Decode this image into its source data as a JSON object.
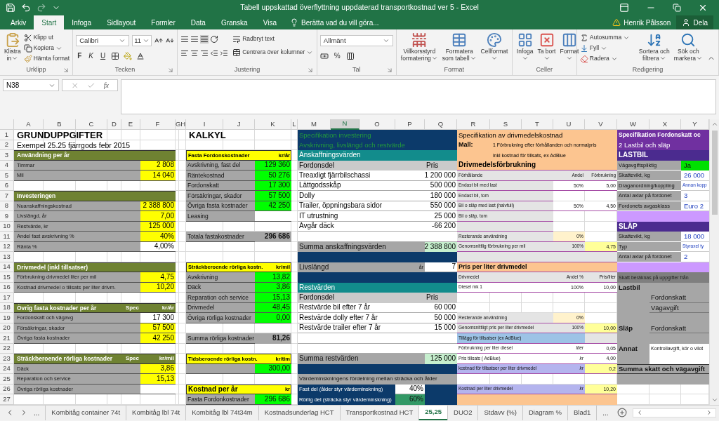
{
  "window": {
    "title": "Tabell uppskattad överflyttning uppdaterad transportkostnad ver 5 - Excel"
  },
  "tabs": [
    {
      "label": "Arkiv",
      "selected": false
    },
    {
      "label": "Start",
      "selected": true
    },
    {
      "label": "Infoga",
      "selected": false
    },
    {
      "label": "Sidlayout",
      "selected": false
    },
    {
      "label": "Formler",
      "selected": false
    },
    {
      "label": "Data",
      "selected": false
    },
    {
      "label": "Granska",
      "selected": false
    },
    {
      "label": "Visa",
      "selected": false
    }
  ],
  "tell_me": "Berätta vad du vill göra...",
  "user": "Henrik Pålsson",
  "share": "Dela",
  "ribbon": {
    "clipboard": {
      "paste": [
        "Klistra",
        "in"
      ],
      "cut": "Klipp ut",
      "copy": "Kopiera",
      "painter": "Hämta format",
      "label": "Urklipp"
    },
    "font": {
      "name": "Calibri",
      "size": "11",
      "bold": "F",
      "italic": "K",
      "underline": "U",
      "label": "Tecken"
    },
    "alignment": {
      "wrap": "Radbryt text",
      "merge": "Centrera över kolumner",
      "label": "Justering"
    },
    "number": {
      "format": "Allmänt",
      "percent": "%",
      "label": "Tal"
    },
    "styles": {
      "conditional": [
        "Villkorsstyrd",
        "formatering"
      ],
      "table": [
        "Formatera",
        "som tabell"
      ],
      "cell": [
        "Cellformat"
      ],
      "label": "Format"
    },
    "cells": {
      "insert": "Infoga",
      "delete": "Ta bort",
      "format": "Format",
      "label": "Celler"
    },
    "editing": {
      "autosum": "Autosumma",
      "fill": "Fyll",
      "clear": "Radera",
      "sort": [
        "Sortera och",
        "filtrera"
      ],
      "find": [
        "Sök och",
        "markera"
      ],
      "label": "Redigering"
    }
  },
  "formula_bar": {
    "name_box": "N38",
    "fx": "fx"
  },
  "sheet": {
    "columns": [
      {
        "label": "A",
        "selected": false
      },
      {
        "label": "B",
        "selected": false
      },
      {
        "label": "C",
        "selected": false
      },
      {
        "label": "D",
        "selected": false
      },
      {
        "label": "E",
        "selected": false
      },
      {
        "label": "F",
        "selected": false
      },
      {
        "label": "GH",
        "selected": false
      },
      {
        "label": "I",
        "selected": false
      },
      {
        "label": "J",
        "selected": false
      },
      {
        "label": "K",
        "selected": false
      },
      {
        "label": "L",
        "selected": false
      },
      {
        "label": "M",
        "selected": false
      },
      {
        "label": "N",
        "selected": true
      },
      {
        "label": "O",
        "selected": false
      },
      {
        "label": "P",
        "selected": false
      },
      {
        "label": "Q",
        "selected": false
      },
      {
        "label": "R",
        "selected": false
      },
      {
        "label": "S",
        "selected": false
      },
      {
        "label": "T",
        "selected": false
      },
      {
        "label": "U",
        "selected": false
      },
      {
        "label": "V",
        "selected": false
      },
      {
        "label": "W",
        "selected": false
      },
      {
        "label": "X",
        "selected": false
      },
      {
        "label": "Y",
        "selected": false
      }
    ],
    "rows": [
      "1",
      "2",
      "3",
      "4",
      "5",
      "6",
      "7",
      "8",
      "9",
      "10",
      "11",
      "12",
      "13",
      "14",
      "15",
      "16",
      "17",
      "18",
      "19",
      "20",
      "21",
      "22",
      "23",
      "24",
      "25",
      "26",
      "27"
    ],
    "cells": [
      {
        "text": "GRUNDUPPGIFTER",
        "kind": "title"
      },
      {
        "text": "Exempel 25.25 fjärrgods febr 2015",
        "kind": "note"
      },
      {
        "text": "Användning per år",
        "kind": "olive"
      },
      {
        "text": "Timmar",
        "kind": "gray"
      },
      {
        "text": "2 808",
        "kind": "yellow"
      },
      {
        "text": "Mil",
        "kind": "gray"
      },
      {
        "text": "14 040",
        "kind": "yellow"
      },
      {
        "text": "Investeringen",
        "kind": "olive"
      },
      {
        "text": "Nuanskaffningskostnad",
        "kind": "gray"
      },
      {
        "text": "2 388 800",
        "kind": "yellow"
      },
      {
        "text": "Livslängd, år",
        "kind": "gray"
      },
      {
        "text": "7,00",
        "kind": "yellow"
      },
      {
        "text": "Restvärde, kr",
        "kind": "gray"
      },
      {
        "text": "125 000",
        "kind": "yellow"
      },
      {
        "text": "Andel fast avskrivning %",
        "kind": "gray"
      },
      {
        "text": "40%",
        "kind": "yellow"
      },
      {
        "text": "Ränta %",
        "kind": "gray"
      },
      {
        "text": "4,00%",
        "kind": "white"
      },
      {
        "text": "Drivmedel (inkl tillsatser)",
        "kind": "olive"
      },
      {
        "text": "Förbrukning drivmedel liter per mil",
        "kind": "gray"
      },
      {
        "text": "4,75",
        "kind": "yellow"
      },
      {
        "text": "Kostnad drivmedel o tillsats per liter drivm.",
        "kind": "gray"
      },
      {
        "text": "10,20",
        "kind": "yellow"
      },
      {
        "text": "Övrig fasta kostnader per år",
        "kind": "olive"
      },
      {
        "text": "Spec",
        "kind": "oliver"
      },
      {
        "text": "kr/år",
        "kind": "oliver"
      },
      {
        "text": "Fordonskatt och vägavg",
        "kind": "gray"
      },
      {
        "text": "17 300",
        "kind": "white"
      },
      {
        "text": "Försäkringar, skador",
        "kind": "gray"
      },
      {
        "text": "57 500",
        "kind": "yellow"
      },
      {
        "text": "Övriga fasta kostnader",
        "kind": "gray"
      },
      {
        "text": "42 250",
        "kind": "yellow"
      },
      {
        "text": "Sträckberoende rörliga kostnader",
        "kind": "olive"
      },
      {
        "text": "Spec",
        "kind": "oliver"
      },
      {
        "text": "kr/mil",
        "kind": "oliver"
      },
      {
        "text": "Däck",
        "kind": "gray"
      },
      {
        "text": "3,86",
        "kind": "yellow"
      },
      {
        "text": "Reparation och service",
        "kind": "gray"
      },
      {
        "text": "15,13",
        "kind": "yellow"
      },
      {
        "text": "Övriga rörliga kostnader",
        "kind": "gray"
      },
      {
        "kind": "white"
      },
      {
        "text": "KALKYL",
        "kind": "title"
      },
      {
        "text": "Fasta Fordonskostnader",
        "kind": "ybar"
      },
      {
        "text": "kr/år",
        "kind": "ybarr"
      },
      {
        "text": "Avskrivning, fast del",
        "kind": "grayl"
      },
      {
        "text": "129 360",
        "kind": "green"
      },
      {
        "text": "Räntekostnad",
        "kind": "grayl"
      },
      {
        "text": "50 276",
        "kind": "green"
      },
      {
        "text": "Fordonskatt",
        "kind": "grayl"
      },
      {
        "text": "17 300",
        "kind": "green"
      },
      {
        "text": "Försäkringar, skador",
        "kind": "grayl"
      },
      {
        "text": "57 500",
        "kind": "green"
      },
      {
        "text": "Övriga fasta kostnader",
        "kind": "grayl"
      },
      {
        "text": "42 250",
        "kind": "green"
      },
      {
        "text": "Leasing",
        "kind": "grayl"
      },
      {
        "kind": "white"
      },
      {
        "text": "Totala fastakostnader",
        "kind": "grayl"
      },
      {
        "text": "296 686",
        "kind": "graytot"
      },
      {
        "text": "Sträckberoende rörliga kostn.",
        "kind": "ybar"
      },
      {
        "text": "kr/mil",
        "kind": "ybarr"
      },
      {
        "text": "Avskrivning",
        "kind": "grayl"
      },
      {
        "text": "13,82",
        "kind": "green"
      },
      {
        "text": "Däck",
        "kind": "grayl"
      },
      {
        "text": "3,86",
        "kind": "green"
      },
      {
        "text": "Reparation och service",
        "kind": "grayl"
      },
      {
        "text": "15,13",
        "kind": "green"
      },
      {
        "text": "Drivmedel",
        "kind": "grayl"
      },
      {
        "text": "48,45",
        "kind": "green"
      },
      {
        "text": "Övriga rörliga kostnader",
        "kind": "grayl"
      },
      {
        "text": "0,00",
        "kind": "green"
      },
      {
        "text": "Summa rörliga kostnader",
        "kind": "grayl"
      },
      {
        "text": "81,26",
        "kind": "graytot"
      },
      {
        "text": "Tidsberoende rörliga kostn.",
        "kind": "ybar"
      },
      {
        "text": "kr/tim",
        "kind": "ybarr"
      },
      {
        "kind": "grayl"
      },
      {
        "text": "300,00",
        "kind": "green"
      },
      {
        "text": "Kostnad per år",
        "kind": "ybarb"
      },
      {
        "text": "kr",
        "kind": "ybarr"
      },
      {
        "text": "Fasta Fordonkostnader",
        "kind": "grayl"
      },
      {
        "text": "296 686",
        "kind": "green"
      },
      {
        "kind": "navy"
      },
      {
        "text": "Specifikation investering",
        "kind": "navyg"
      },
      {
        "text": "Avskrivning, livslängd och restvärde",
        "kind": "navyg"
      },
      {
        "text": "Anskaffningsvärden",
        "kind": "teal"
      },
      {
        "text": "Fordonsdel",
        "kind": "lgray"
      },
      {
        "text": "Pris",
        "kind": "lgray"
      },
      {
        "text": "Treaxligt fjärrbilschassi",
        "kind": "wrow"
      },
      {
        "text": "1 200 000",
        "kind": "wnum"
      },
      {
        "text": "Lättgodsskåp",
        "kind": "wrow"
      },
      {
        "text": "500 000",
        "kind": "wnum"
      },
      {
        "text": "Dolly",
        "kind": "wrow"
      },
      {
        "text": "180 000",
        "kind": "wnum"
      },
      {
        "text": "Trailer, öppningsbara sidor",
        "kind": "wrow"
      },
      {
        "text": "550 000",
        "kind": "wnum"
      },
      {
        "text": "IT utrustning",
        "kind": "wrow"
      },
      {
        "text": "25 000",
        "kind": "wnum"
      },
      {
        "text": "Avgår däck",
        "kind": "wrow"
      },
      {
        "text": "-66 200",
        "kind": "wnum"
      },
      {
        "kind": "wrow"
      },
      {
        "kind": "wnum"
      },
      {
        "text": "Summa anskaffningsvärden",
        "kind": "graym"
      },
      {
        "text": "2 388 800",
        "kind": "pgreen"
      },
      {
        "text": "Livslängd",
        "kind": "graym"
      },
      {
        "text": "år",
        "kind": "graymr"
      },
      {
        "text": "7",
        "kind": "wnum"
      },
      {
        "text": "Restvärden",
        "kind": "teal"
      },
      {
        "text": "Fordonsdel",
        "kind": "lgray"
      },
      {
        "text": "Pris",
        "kind": "lgray"
      },
      {
        "text": "Restvärde bil efter 7 år",
        "kind": "wrow"
      },
      {
        "text": "60 000",
        "kind": "wnum"
      },
      {
        "text": "Restvärde dolly efter 7 år",
        "kind": "wrow"
      },
      {
        "text": "50 000",
        "kind": "wnum"
      },
      {
        "text": "Restvärde trailer efter 7 år",
        "kind": "wrow"
      },
      {
        "text": "15 000",
        "kind": "wnum"
      },
      {
        "kind": "wrow"
      },
      {
        "kind": "wnum"
      },
      {
        "kind": "wrow"
      },
      {
        "kind": "wnum"
      },
      {
        "text": "Summa restvärden",
        "kind": "graym"
      },
      {
        "text": "125 000",
        "kind": "pgreen"
      },
      {
        "text": "Värdeminskningens fördelning mellan sträcka och ålder",
        "kind": "grays"
      },
      {
        "text": "Fast del (ålder styr värdeminskning)",
        "kind": "navys"
      },
      {
        "text": "40%",
        "kind": "wnum"
      },
      {
        "text": "Rörlig del (sträcka styr värdeminskning)",
        "kind": "navys"
      },
      {
        "text": "60%",
        "kind": "dgreen"
      },
      {
        "kind": "peach"
      },
      {
        "text": "Specifikation av drivmedelskostnad",
        "kind": "ptext"
      },
      {
        "text": "Mall:",
        "kind": "pmall"
      },
      {
        "text": "1 Förbrukning efter förhållanden och normalpris",
        "kind": "psmall"
      },
      {
        "text": "inkl kostnad för tillsats, ex AdBlue",
        "kind": "psmall"
      },
      {
        "text": "Drivmedelsförbrukning",
        "kind": "pbold"
      },
      {
        "text": "Förhållande",
        "kind": "pgray"
      },
      {
        "text": "Andel",
        "kind": "pgrayr"
      },
      {
        "text": "Förbrukning",
        "kind": "pgrayr"
      },
      {
        "text": "Endast bil med last",
        "kind": "pgray"
      },
      {
        "text": "50%",
        "kind": "pwhite"
      },
      {
        "text": "5,00",
        "kind": "pwhite"
      },
      {
        "text": "Endast bil, tom",
        "kind": "pgray"
      },
      {
        "text": "Bil o släp med last (halvfull)",
        "kind": "pgray"
      },
      {
        "text": "50%",
        "kind": "pwhite"
      },
      {
        "text": "4,50",
        "kind": "pwhite"
      },
      {
        "text": "Bil o släp, tom",
        "kind": "pgray"
      },
      {
        "kind": "pgray"
      },
      {
        "text": "Resterande användning",
        "kind": "pgray"
      },
      {
        "text": "0%",
        "kind": "pyellow"
      },
      {
        "text": "Genomsnittlig förbrukning per mil",
        "kind": "pgray"
      },
      {
        "text": "100%",
        "kind": "pgrayr"
      },
      {
        "text": "4,75",
        "kind": "pyel"
      },
      {
        "kind": "pgray"
      },
      {
        "text": "Pris per liter drivmedel",
        "kind": "pbar"
      },
      {
        "text": "Drivmedel",
        "kind": "pgray"
      },
      {
        "text": "Andel %",
        "kind": "pgrayr"
      },
      {
        "text": "Pris/liter",
        "kind": "pgrayr"
      },
      {
        "text": "Diesel mk 1",
        "kind": "pwhitel"
      },
      {
        "text": "100%",
        "kind": "pwhite"
      },
      {
        "text": "10,00",
        "kind": "pwhite"
      },
      {
        "text": "Resterande användning",
        "kind": "pgray"
      },
      {
        "text": "0%",
        "kind": "pyellow"
      },
      {
        "text": "Genomsnittligt pris per liter drivmedel",
        "kind": "pgray"
      },
      {
        "text": "100%",
        "kind": "pgrayr"
      },
      {
        "text": "10,00",
        "kind": "pyel"
      },
      {
        "text": "Tillägg för tillsatser (ex AdBlue)",
        "kind": "blue"
      },
      {
        "kind": "pgray"
      },
      {
        "text": "Förbrukning per liter diesel",
        "kind": "pwhitel"
      },
      {
        "text": "liter",
        "kind": "pwhitei"
      },
      {
        "text": "0,05",
        "kind": "pwhite"
      },
      {
        "text": "Pris tillsats ( AdBlue)",
        "kind": "pwhitel"
      },
      {
        "text": "kr",
        "kind": "pwhitei"
      },
      {
        "text": "4,00",
        "kind": "pwhite"
      },
      {
        "text": "kostnad för tillsatser per liter drivmedel",
        "kind": "peri"
      },
      {
        "text": "kr",
        "kind": "perii"
      },
      {
        "text": "0,2",
        "kind": "pyel"
      },
      {
        "text": "Kostnad per liter drivmedel",
        "kind": "peri"
      },
      {
        "text": "kr",
        "kind": "perii"
      },
      {
        "text": "10,20",
        "kind": "pyel"
      },
      {
        "kind": "peach"
      },
      {
        "text": "Specifikation Fordonskatt oc",
        "kind": "purple"
      },
      {
        "text": "2 Lastbil och släp",
        "kind": "purples"
      },
      {
        "text": "LASTBIL",
        "kind": "indigo"
      },
      {
        "text": "Vägavgiftspliktig",
        "kind": "wgray"
      },
      {
        "text": "Ja",
        "kind": "wgreen"
      },
      {
        "text": "Skattevikt, kg",
        "kind": "wgray"
      },
      {
        "text": "26 000",
        "kind": "wval"
      },
      {
        "text": "Draganordning/koppling",
        "kind": "wgray"
      },
      {
        "text": "Annan kopp",
        "kind": "wvals"
      },
      {
        "text": "Antal axlar på fordonet",
        "kind": "wgray"
      },
      {
        "text": "3",
        "kind": "wval"
      },
      {
        "text": "Fordonets avgasklass",
        "kind": "wgray"
      },
      {
        "text": "Euro 2",
        "kind": "wval"
      },
      {
        "kind": "lilac"
      },
      {
        "text": "SLÄP",
        "kind": "indigo"
      },
      {
        "text": "Skattevikt, kg",
        "kind": "wgray"
      },
      {
        "text": "18 000",
        "kind": "wval"
      },
      {
        "text": "Typ",
        "kind": "wgray"
      },
      {
        "text": "Styraxel ty",
        "kind": "wvals"
      },
      {
        "text": "Antal axlar på fordonet",
        "kind": "wgray"
      },
      {
        "text": "2",
        "kind": "wval"
      },
      {
        "kind": "lilac"
      },
      {
        "text": "Skatt beräknas på uppgifter från",
        "kind": "dgray"
      },
      {
        "kind": "bgray"
      },
      {
        "text": "Lastbil",
        "kind": "wbold"
      },
      {
        "text": "Fordonskatt",
        "kind": "wtext"
      },
      {
        "text": "Vägavgift",
        "kind": "wtext"
      },
      {
        "text": "Släp",
        "kind": "wbold"
      },
      {
        "text": "Fordonskatt",
        "kind": "wtext"
      },
      {
        "text": "Annat",
        "kind": "wbold"
      },
      {
        "text": "Kontrollavgift, kör o vilot",
        "kind": "wbox"
      },
      {
        "kind": "wbox"
      },
      {
        "text": "Summa skatt och vägavgift",
        "kind": "sumbar"
      },
      {
        "kind": "bgray"
      }
    ]
  },
  "sheet_tabs": {
    "more_left": "...",
    "more_right": "...",
    "tabs": [
      {
        "label": "Kombitåg container 74t",
        "selected": false
      },
      {
        "label": "Kombitåg lbl 74t",
        "selected": false
      },
      {
        "label": "Kombitåg lbl 74t34m",
        "selected": false
      },
      {
        "label": "Kostnadsunderlag HCT",
        "selected": false
      },
      {
        "label": "Transportkostnad HCT",
        "selected": false
      },
      {
        "label": "25,25",
        "selected": true
      },
      {
        "label": "DUO2",
        "selected": false
      },
      {
        "label": "Stdavv (%)",
        "selected": false
      },
      {
        "label": "Diagram %",
        "selected": false
      },
      {
        "label": "Blad1",
        "selected": false
      }
    ]
  }
}
